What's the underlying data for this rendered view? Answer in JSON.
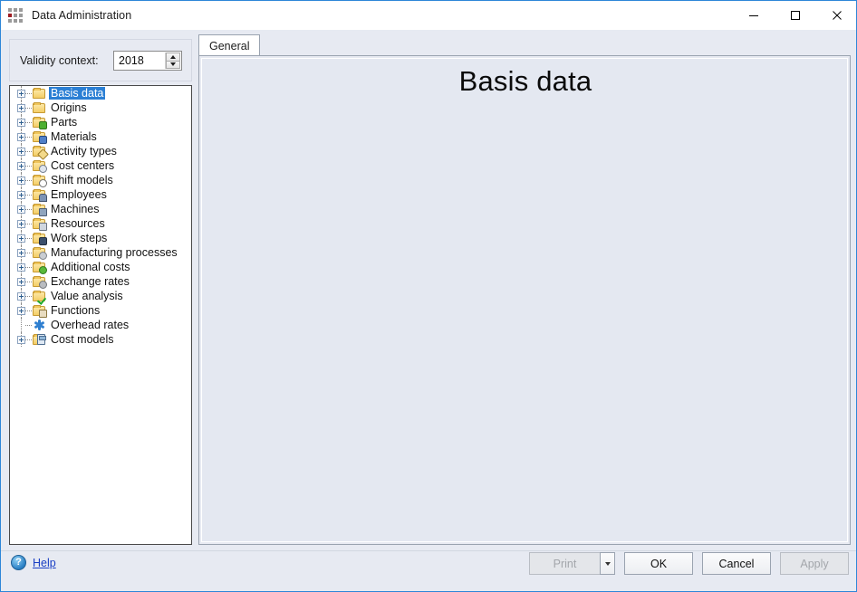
{
  "window": {
    "title": "Data Administration",
    "app_icon": "grid-app-icon",
    "controls": {
      "minimize": "minimize-icon",
      "maximize": "maximize-icon",
      "close": "close-icon"
    }
  },
  "validity": {
    "label": "Validity context:",
    "value": "2018",
    "spinner_up": "spin-up-icon",
    "spinner_down": "spin-down-icon"
  },
  "tree": {
    "items": [
      {
        "label": "Basis data",
        "icon": "folder-icon",
        "expandable": true,
        "selected": true
      },
      {
        "label": "Origins",
        "icon": "folder-icon",
        "expandable": true,
        "selected": false
      },
      {
        "label": "Parts",
        "icon": "folder-parts-icon",
        "expandable": true,
        "selected": false
      },
      {
        "label": "Materials",
        "icon": "folder-materials-icon",
        "expandable": true,
        "selected": false
      },
      {
        "label": "Activity types",
        "icon": "folder-activity-icon",
        "expandable": true,
        "selected": false
      },
      {
        "label": "Cost centers",
        "icon": "folder-cost-center-icon",
        "expandable": true,
        "selected": false
      },
      {
        "label": "Shift models",
        "icon": "folder-shift-icon",
        "expandable": true,
        "selected": false
      },
      {
        "label": "Employees",
        "icon": "folder-employee-icon",
        "expandable": true,
        "selected": false
      },
      {
        "label": "Machines",
        "icon": "folder-machine-icon",
        "expandable": true,
        "selected": false
      },
      {
        "label": "Resources",
        "icon": "folder-resources-icon",
        "expandable": true,
        "selected": false
      },
      {
        "label": "Work steps",
        "icon": "folder-work-steps-icon",
        "expandable": true,
        "selected": false
      },
      {
        "label": "Manufacturing processes",
        "icon": "folder-manufacturing-icon",
        "expandable": true,
        "selected": false
      },
      {
        "label": "Additional costs",
        "icon": "folder-additional-costs-icon",
        "expandable": true,
        "selected": false
      },
      {
        "label": "Exchange rates",
        "icon": "folder-exchange-rates-icon",
        "expandable": true,
        "selected": false
      },
      {
        "label": "Value analysis",
        "icon": "folder-value-analysis-icon",
        "expandable": true,
        "selected": false
      },
      {
        "label": "Functions",
        "icon": "folder-functions-icon",
        "expandable": true,
        "selected": false
      },
      {
        "label": "Overhead rates",
        "icon": "propeller-icon",
        "expandable": false,
        "selected": false
      },
      {
        "label": "Cost models",
        "icon": "calculator-icon",
        "expandable": true,
        "selected": false
      }
    ]
  },
  "tabs": [
    {
      "label": "General",
      "active": true
    }
  ],
  "content": {
    "heading": "Basis data"
  },
  "footer": {
    "help_label": "Help",
    "help_icon": "question-mark-icon",
    "print_label": "Print",
    "print_dropdown_icon": "chevron-down-icon",
    "ok_label": "OK",
    "cancel_label": "Cancel",
    "apply_label": "Apply"
  },
  "colors": {
    "window_border": "#2e86d8",
    "dialog_bg": "#e7eaf2",
    "selection": "#2b7fd4",
    "link": "#1a3fc4",
    "folder": "#f4cd66"
  }
}
